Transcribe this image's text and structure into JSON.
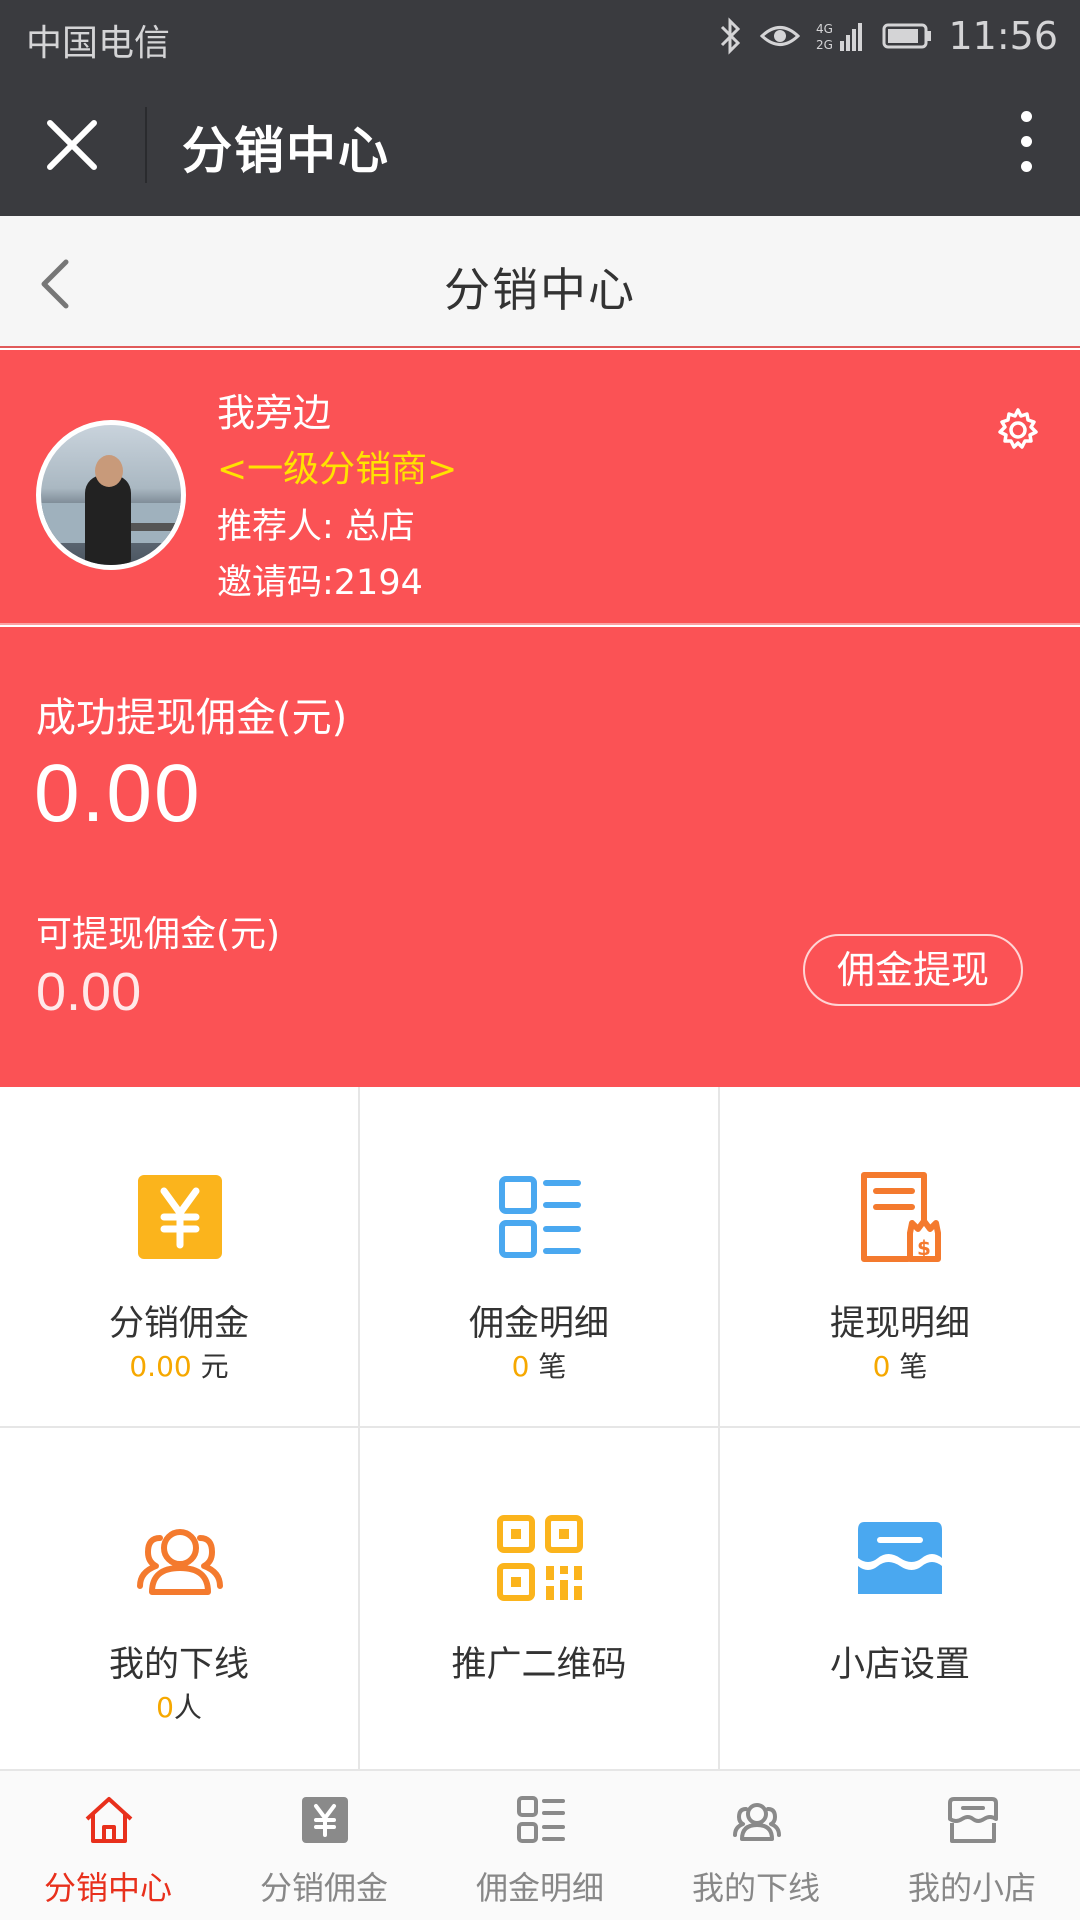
{
  "status_bar": {
    "carrier": "中国电信",
    "network": "4G 2G",
    "time": "11:56"
  },
  "wechat_bar": {
    "title": "分销中心"
  },
  "header": {
    "title": "分销中心"
  },
  "profile": {
    "name": "我旁边",
    "level": "<一级分销商>",
    "referrer": "推荐人: 总店",
    "invite_code": "邀请码:2194"
  },
  "commission": {
    "success_label": "成功提现佣金(元)",
    "success_value": "0.00",
    "available_label": "可提现佣金(元)",
    "available_value": "0.00",
    "withdraw_button": "佣金提现"
  },
  "grid": [
    {
      "label": "分销佣金",
      "value": "0.00",
      "unit": "元",
      "icon": "yen-icon"
    },
    {
      "label": "佣金明细",
      "value": "0",
      "unit": "笔",
      "icon": "list-icon"
    },
    {
      "label": "提现明细",
      "value": "0",
      "unit": "笔",
      "icon": "receipt-icon"
    },
    {
      "label": "我的下线",
      "value": "0",
      "unit": "人",
      "icon": "users-icon"
    },
    {
      "label": "推广二维码",
      "icon": "qr-code-icon"
    },
    {
      "label": "小店设置",
      "icon": "store-icon"
    }
  ],
  "tabbar": [
    {
      "label": "分销中心",
      "icon": "home-icon",
      "active": true
    },
    {
      "label": "分销佣金",
      "icon": "yen-icon"
    },
    {
      "label": "佣金明细",
      "icon": "list-icon"
    },
    {
      "label": "我的下线",
      "icon": "users-icon"
    },
    {
      "label": "我的小店",
      "icon": "store-icon"
    }
  ],
  "colors": {
    "status_bar_bg": "#3a3b3f",
    "accent_red": "#fb5255",
    "level_yellow": "#ffe200",
    "value_orange": "#f6a800",
    "tab_active": "#e8301c",
    "icon_blue": "#4aa8f0",
    "icon_orange": "#f47a2e"
  }
}
